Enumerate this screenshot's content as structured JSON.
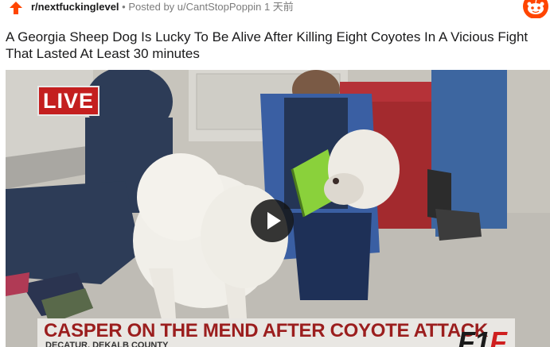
{
  "post": {
    "subreddit": "r/nextfuckinglevel",
    "separator": "•",
    "posted_by": "Posted by u/CantStopPoppin",
    "time_ago": "1 天前",
    "title": "A Georgia Sheep Dog Is Lucky To Be Alive After Killing Eight Coyotes In A Vicious Fight That Lasted At Least 30 minutes"
  },
  "video": {
    "live_badge": "LIVE",
    "lower_third_title": "CASPER ON THE MEND AFTER COYOTE ATTACK",
    "lower_third_subtitle": "DECATUR, DEKALB COUNTY",
    "station_logo": {
      "left": "F1",
      "accent": "F",
      "right": ""
    }
  },
  "icons": {
    "upvote": "upvote-arrow-icon",
    "reddit": "reddit-snoo-icon",
    "play": "play-icon"
  },
  "colors": {
    "upvote": "#ff4500",
    "reddit_orange": "#ff4500",
    "live_red": "#c41f1f",
    "lower_third_text": "#9b1e1e"
  }
}
